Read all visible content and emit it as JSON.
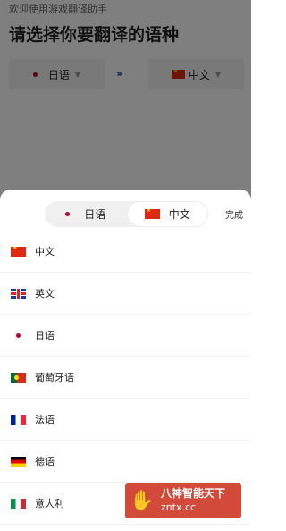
{
  "background": {
    "welcome": "欢迎使用游戏翻译助手",
    "heading": "请选择你要翻译的语种",
    "source_lang": "日语",
    "target_lang": "中文"
  },
  "sheet": {
    "segment": {
      "source": "日语",
      "target": "中文"
    },
    "done_label": "完成",
    "languages": [
      {
        "name": "中文",
        "flag": "cn-flag-icon"
      },
      {
        "name": "英文",
        "flag": "uk-flag-icon"
      },
      {
        "name": "日语",
        "flag": "jp-flag-icon"
      },
      {
        "name": "葡萄牙语",
        "flag": "pt-flag-icon"
      },
      {
        "name": "法语",
        "flag": "fr-flag-icon"
      },
      {
        "name": "德语",
        "flag": "de-flag-icon"
      },
      {
        "name": "意大利",
        "flag": "it-flag-icon"
      }
    ]
  },
  "watermark": {
    "line1": "八神智能天下",
    "line2": "zntx.cc"
  },
  "colors": {
    "overlay": "#000000",
    "accent_arrows": "#3a5fcf",
    "watermark_bg": "#d24b3a"
  }
}
